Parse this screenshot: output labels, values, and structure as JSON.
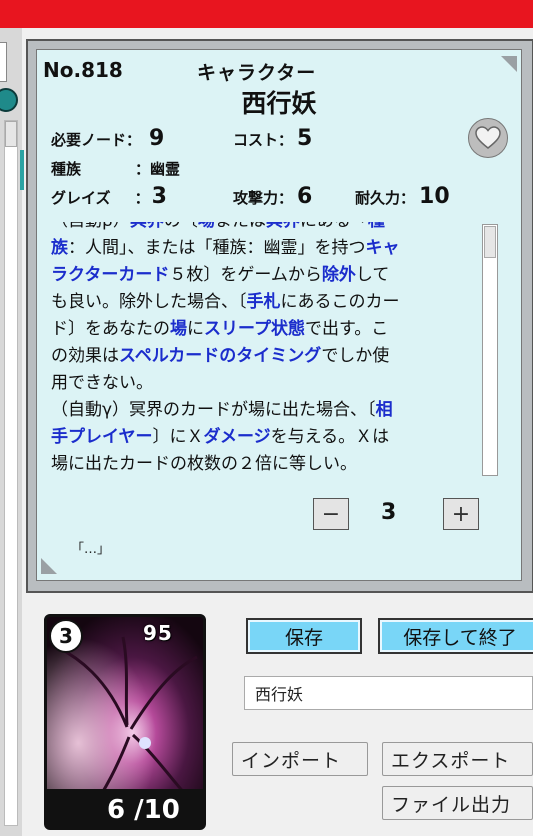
{
  "card": {
    "number": "No.818",
    "type": "キャラクター",
    "name": "西行妖",
    "stats": {
      "node_label": "必要ノード：",
      "node": "9",
      "cost_label": "コスト：",
      "cost": "5",
      "race_label": "種族",
      "race": "：幽霊",
      "graze_label": "グレイズ",
      "graze_sep": "：",
      "graze": "3",
      "attack_label": "攻撃力：",
      "attack": "6",
      "durability_label": "耐久力：",
      "durability": "10"
    },
    "text_lines": [
      [
        {
          "t": "（自動β）",
          "k": false
        },
        {
          "t": "冥界",
          "k": true
        },
        {
          "t": "の〔",
          "k": false
        },
        {
          "t": "場",
          "k": true
        },
        {
          "t": "または",
          "k": false
        },
        {
          "t": "冥界",
          "k": true
        },
        {
          "t": "にある「",
          "k": false
        },
        {
          "t": "種",
          "k": true
        }
      ],
      [
        {
          "t": "族",
          "k": true
        },
        {
          "t": "：人間」、または「種族：幽霊」を持つ",
          "k": false
        },
        {
          "t": "キャ",
          "k": true
        }
      ],
      [
        {
          "t": "ラクターカード",
          "k": true
        },
        {
          "t": "５枚〕をゲームから",
          "k": false
        },
        {
          "t": "除外",
          "k": true
        },
        {
          "t": "して",
          "k": false
        }
      ],
      [
        {
          "t": "も良い。除外した場合、〔",
          "k": false
        },
        {
          "t": "手札",
          "k": true
        },
        {
          "t": "にあるこのカー",
          "k": false
        }
      ],
      [
        {
          "t": "ド〕をあなたの",
          "k": false
        },
        {
          "t": "場",
          "k": true
        },
        {
          "t": "に",
          "k": false
        },
        {
          "t": "スリープ状態",
          "k": true
        },
        {
          "t": "で出す。こ",
          "k": false
        }
      ],
      [
        {
          "t": "の効果は",
          "k": false
        },
        {
          "t": "スペルカードのタイミング",
          "k": true
        },
        {
          "t": "でしか使",
          "k": false
        }
      ],
      [
        {
          "t": "用できない。",
          "k": false
        }
      ],
      [
        {
          "t": "（自動γ）冥界のカードが場に出た場合、〔",
          "k": false
        },
        {
          "t": "相",
          "k": true
        }
      ],
      [
        {
          "t": "手プレイヤー",
          "k": true
        },
        {
          "t": "〕にＸ",
          "k": false
        },
        {
          "t": "ダメージ",
          "k": true
        },
        {
          "t": "を与える。Ｘは",
          "k": false
        }
      ],
      [
        {
          "t": "場に出たカードの枚数の２倍に等しい。",
          "k": false
        }
      ]
    ],
    "stepper": {
      "minus": "−",
      "value": "3",
      "plus": "+"
    },
    "flavor": "「…」"
  },
  "thumbnail": {
    "cost": "3",
    "node_graze": "95",
    "attack": "6",
    "durability": "10",
    "stats_text": "6 /10"
  },
  "actions": {
    "save": "保存",
    "save_exit": "保存して終了",
    "name_value": "西行妖",
    "import": "インポート",
    "export": "エクスポート",
    "file_output": "ファイル出力"
  },
  "colors": {
    "topbar": "#e8151f",
    "card_bg": "#dcf3f5",
    "keyword": "#1b2dcc",
    "button_blue": "#79d6f7"
  }
}
